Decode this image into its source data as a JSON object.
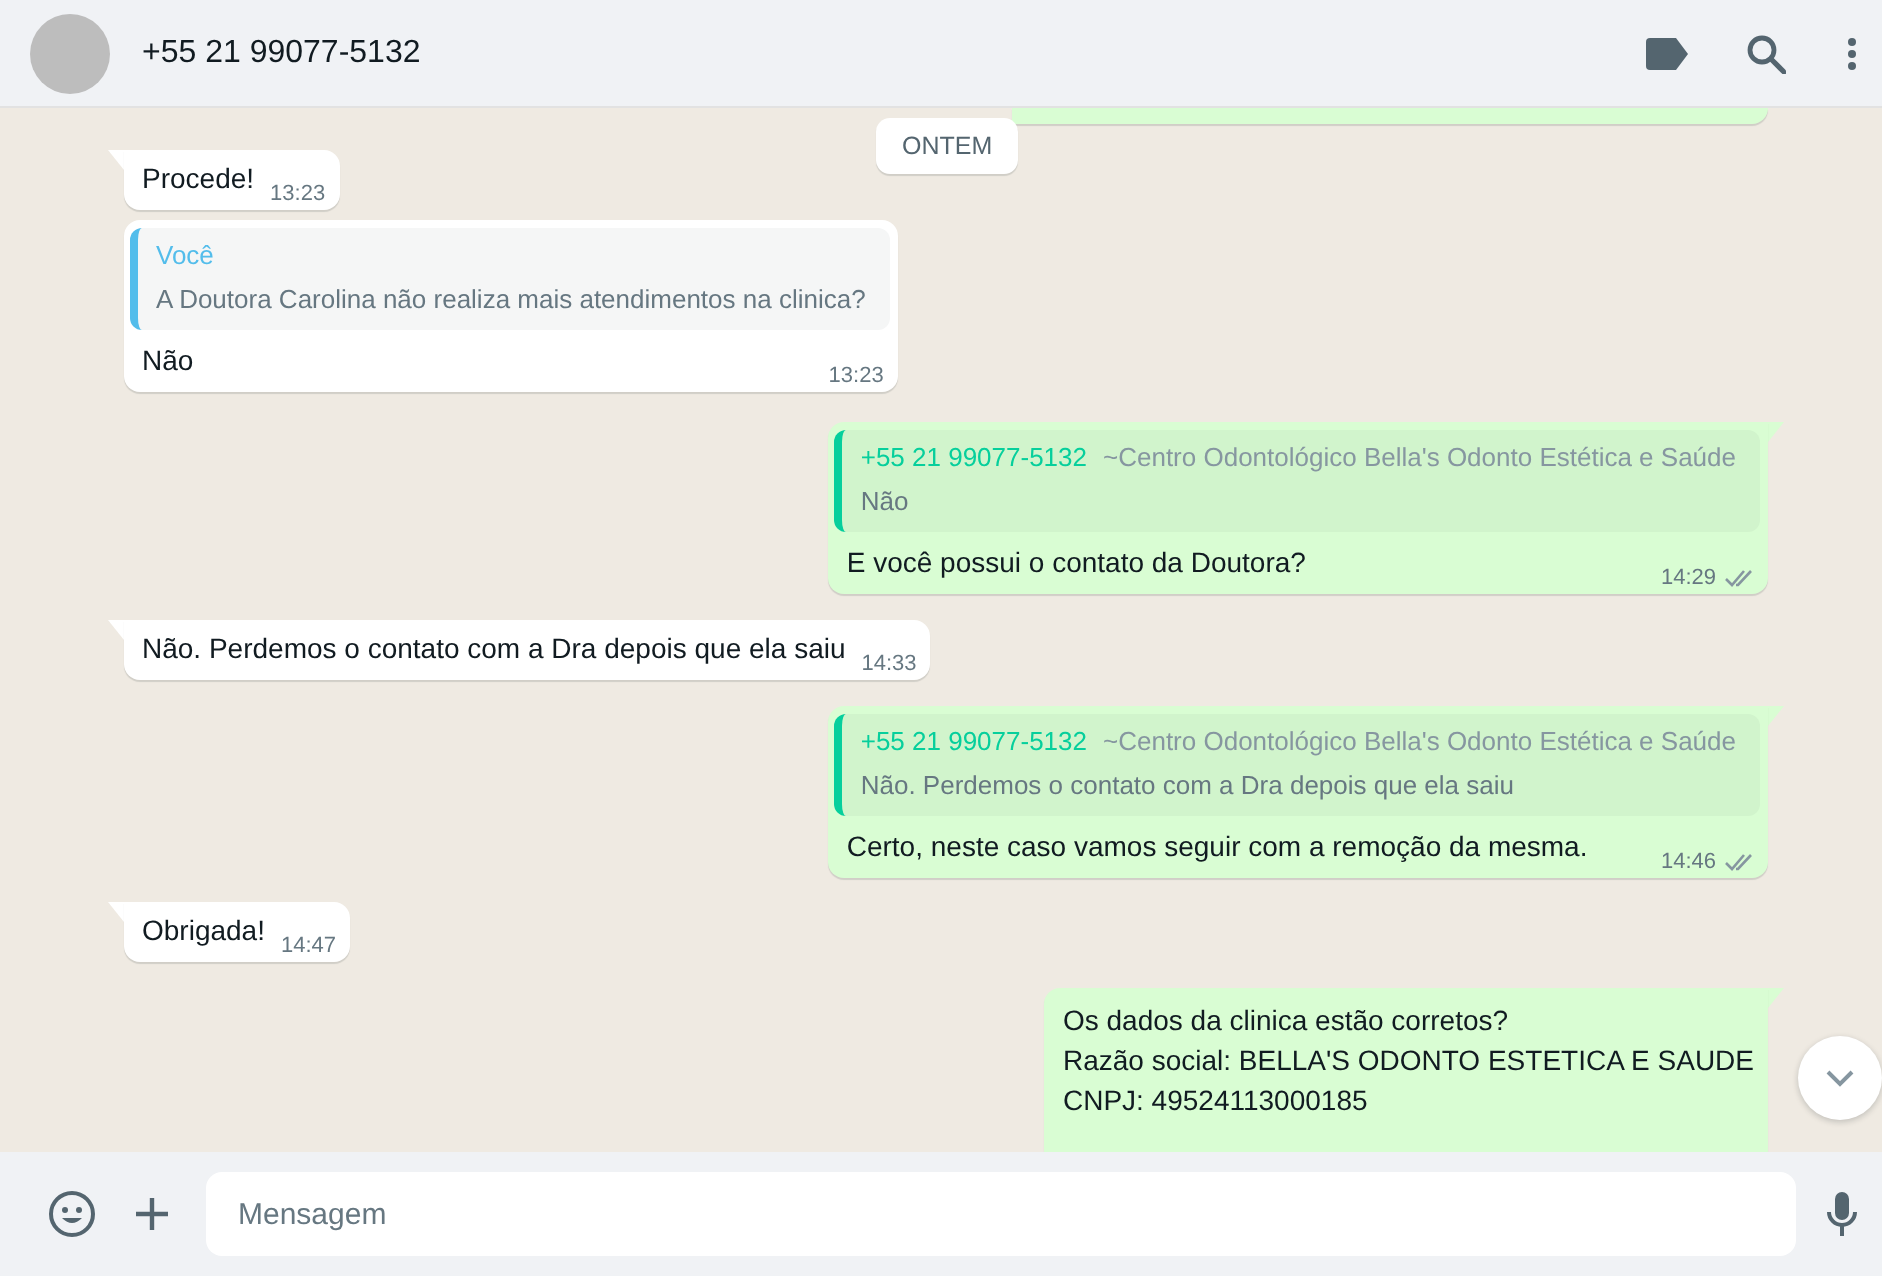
{
  "header": {
    "title": "+55 21 99077-5132"
  },
  "date_chip": "ONTEM",
  "messages": [
    {
      "outgoing": true,
      "kind": "cut",
      "tail": false
    },
    {
      "outgoing": false,
      "kind": "text",
      "tail": true,
      "text": "Procede!",
      "time": "13:23"
    },
    {
      "outgoing": false,
      "kind": "reply",
      "tail": false,
      "quote": {
        "author": "Você",
        "color": "#53bdeb",
        "text": "A Doutora Carolina não realiza mais atendimentos na clinica?"
      },
      "text": "Não",
      "time": "13:23"
    },
    {
      "outgoing": true,
      "kind": "reply",
      "tail": true,
      "quote": {
        "author": "+55 21 99077-5132",
        "push_name": "~Centro Odontológico Bella's Odonto Estética e Saúde",
        "color": "#06cf9c",
        "text": "Não"
      },
      "text": "E você possui o contato da Doutora?",
      "time": "14:29",
      "read": false
    },
    {
      "outgoing": false,
      "kind": "text",
      "tail": true,
      "text": "Não. Perdemos o contato com a Dra depois que ela saiu",
      "time": "14:33"
    },
    {
      "outgoing": true,
      "kind": "reply",
      "tail": true,
      "quote": {
        "author": "+55 21 99077-5132",
        "push_name": "~Centro Odontológico Bella's Odonto Estética e Saúde",
        "color": "#06cf9c",
        "text": "Não. Perdemos o contato com a Dra depois que ela saiu"
      },
      "text": "Certo, neste caso vamos seguir com a remoção da mesma.",
      "time": "14:46",
      "read": false
    },
    {
      "outgoing": false,
      "kind": "text",
      "tail": true,
      "text": "Obrigada!",
      "time": "14:47"
    },
    {
      "outgoing": true,
      "kind": "lines",
      "tail": true,
      "lines": [
        "Os dados da clinica estão corretos?",
        "Razão social: BELLA'S ODONTO ESTETICA E SAUDE",
        "CNPJ: 49524113000185"
      ]
    }
  ],
  "composer": {
    "placeholder": "Mensagem"
  }
}
